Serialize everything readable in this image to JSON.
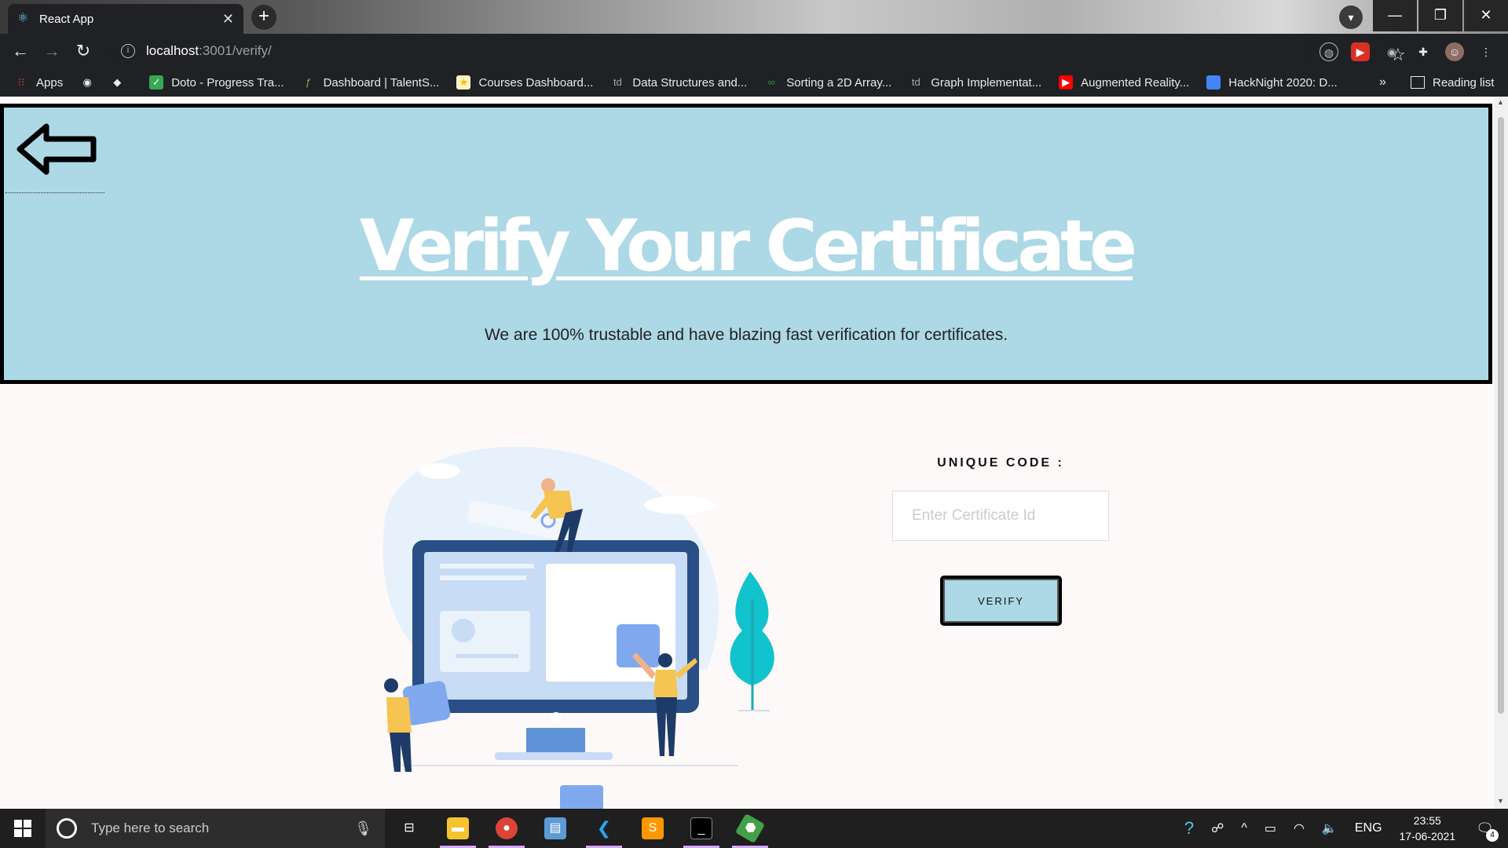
{
  "browser": {
    "tab_title": "React App",
    "tab_close": "✕",
    "new_tab": "+",
    "url_host": "localhost",
    "url_rest": ":3001/verify/",
    "window_controls": {
      "minimize": "—",
      "restore": "❐",
      "close": "✕"
    }
  },
  "bookmarks": {
    "items": [
      {
        "label": "Apps",
        "icon": "apps-grid-icon",
        "color": "#ea4335"
      },
      {
        "label": "",
        "icon": "globe-icon",
        "color": "#ffffff"
      },
      {
        "label": "",
        "icon": "diamond-icon",
        "color": "#ffffff"
      },
      {
        "label": "Doto - Progress Tra...",
        "icon": "checkmark-icon",
        "color": "#34a853"
      },
      {
        "label": "Dashboard | TalentS...",
        "icon": "leaf-icon",
        "color": "#7cb342"
      },
      {
        "label": "Courses Dashboard...",
        "icon": "folder-star-icon",
        "color": "#fbbc04"
      },
      {
        "label": "Data Structures and...",
        "icon": "td-icon",
        "color": "#aaaaaa"
      },
      {
        "label": "Sorting a 2D Array...",
        "icon": "gfg-icon",
        "color": "#2f8d46"
      },
      {
        "label": "Graph Implementat...",
        "icon": "td-icon",
        "color": "#aaaaaa"
      },
      {
        "label": "Augmented Reality...",
        "icon": "youtube-icon",
        "color": "#ff0000"
      },
      {
        "label": "HackNight 2020: D...",
        "icon": "bookmark-blue-icon",
        "color": "#4285f4"
      }
    ],
    "more": "»",
    "reading_list": "Reading list"
  },
  "hero": {
    "title": "Verify Your Certificate",
    "subtitle": "We are 100% trustable and have blazing fast verification for certificates."
  },
  "form": {
    "label": "UNIQUE CODE :",
    "placeholder": "Enter Certificate Id",
    "button": "VERIFY"
  },
  "taskbar": {
    "search_placeholder": "Type here to search",
    "tray_lang": "ENG",
    "time": "23:55",
    "date": "17-06-2021",
    "notification_count": "4"
  },
  "colors": {
    "hero_bg": "#add8e6",
    "page_bg": "#fdf9f9",
    "chrome_bg": "#202124"
  }
}
